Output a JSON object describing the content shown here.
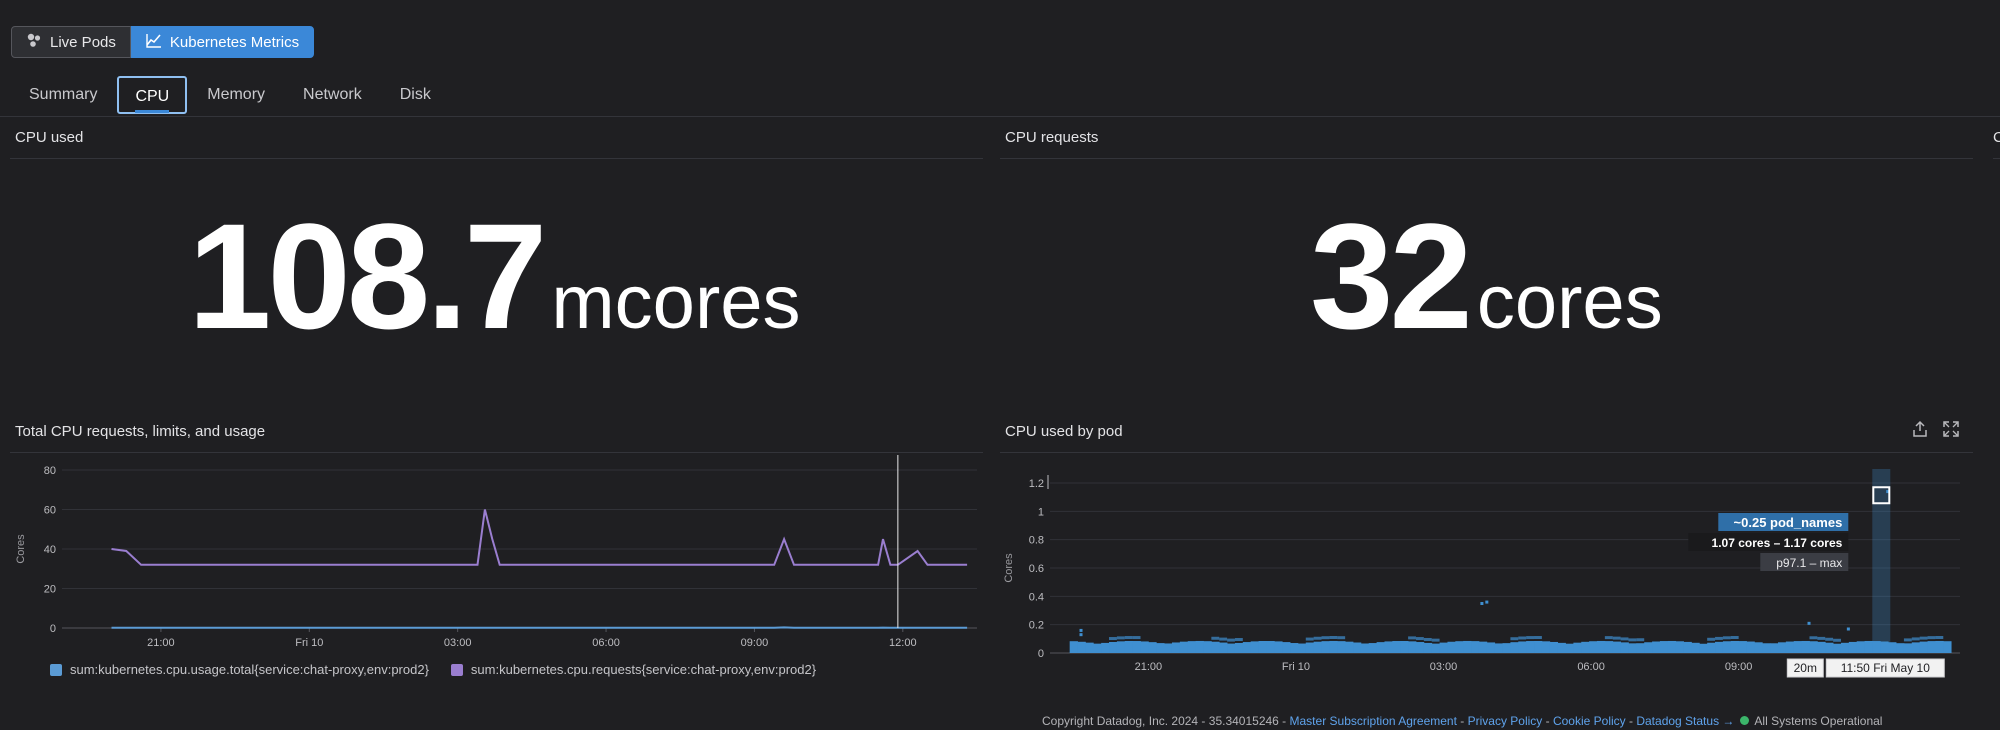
{
  "toggle": {
    "live_pods": "Live Pods",
    "kubernetes_metrics": "Kubernetes Metrics"
  },
  "tabs": [
    "Summary",
    "CPU",
    "Memory",
    "Network",
    "Disk"
  ],
  "cpu_used": {
    "title": "CPU used",
    "value": "108.7",
    "unit": "mcores"
  },
  "cpu_requests": {
    "title": "CPU requests",
    "value": "32",
    "unit": "cores"
  },
  "edge_title_fragment": "C",
  "chart_data": [
    {
      "type": "line",
      "title": "Total CPU requests, limits, and usage",
      "ylabel": "Cores",
      "ylim": [
        0,
        80
      ],
      "yticks": [
        "80",
        "60",
        "40",
        "20",
        "0"
      ],
      "xticks": [
        "21:00",
        "Fri 10",
        "03:00",
        "06:00",
        "09:00",
        "12:00"
      ],
      "x_hours": [
        -4,
        -3.7,
        -3.4,
        -1,
        3.4,
        3.55,
        3.7,
        3.85,
        9.4,
        9.6,
        9.8,
        11.5,
        11.6,
        11.75,
        11.9,
        12.3,
        12.5,
        13.3
      ],
      "series": [
        {
          "name": "sum:kubernetes.cpu.usage.total{service:chat-proxy,env:prod2}",
          "color": "#5b9bd5",
          "values": [
            0.1,
            0.1,
            0.1,
            0.1,
            0.1,
            0.1,
            0.1,
            0.1,
            0.1,
            0.3,
            0.1,
            0.1,
            0.2,
            0.1,
            0.1,
            0.1,
            0.1,
            0.1
          ]
        },
        {
          "name": "sum:kubernetes.cpu.requests{service:chat-proxy,env:prod2}",
          "color": "#9a7ed0",
          "values": [
            40,
            39,
            32,
            32,
            32,
            60,
            45,
            32,
            32,
            45,
            32,
            32,
            45,
            32,
            32,
            39,
            32,
            32
          ]
        }
      ],
      "cursor_hour": 11.9
    },
    {
      "type": "heatmap",
      "title": "CPU used by pod",
      "ylabel": "Cores",
      "ylim": [
        0,
        1.2
      ],
      "yticks": [
        "1.2",
        "1",
        "0.8",
        "0.6",
        "0.4",
        "0.2",
        "0"
      ],
      "xticks": [
        "21:00",
        "Fri 10",
        "03:00",
        "06:00",
        "09:00",
        "12:00"
      ],
      "tooltip": {
        "count": "~0.25 pod_names",
        "range": "1.07 cores – 1.17 cores",
        "percentile": "p97.1 – max"
      },
      "time_badge": {
        "span": "20m",
        "time": "11:50 Fri May 10"
      }
    }
  ],
  "footer": {
    "copyright": "Copyright Datadog, Inc. 2024 - 35.34015246 -",
    "links": [
      "Master Subscription Agreement",
      "Privacy Policy",
      "Cookie Policy",
      "Datadog Status →"
    ],
    "status": "All Systems Operational"
  },
  "colors": {
    "accent": "#3b88d8",
    "usage": "#5b9bd5",
    "requests": "#9a7ed0",
    "heat": "#3f8fd0",
    "ok": "#3bb56a"
  },
  "icons": [
    "pods-icon",
    "chart-line-icon",
    "export-icon",
    "fullscreen-icon"
  ]
}
